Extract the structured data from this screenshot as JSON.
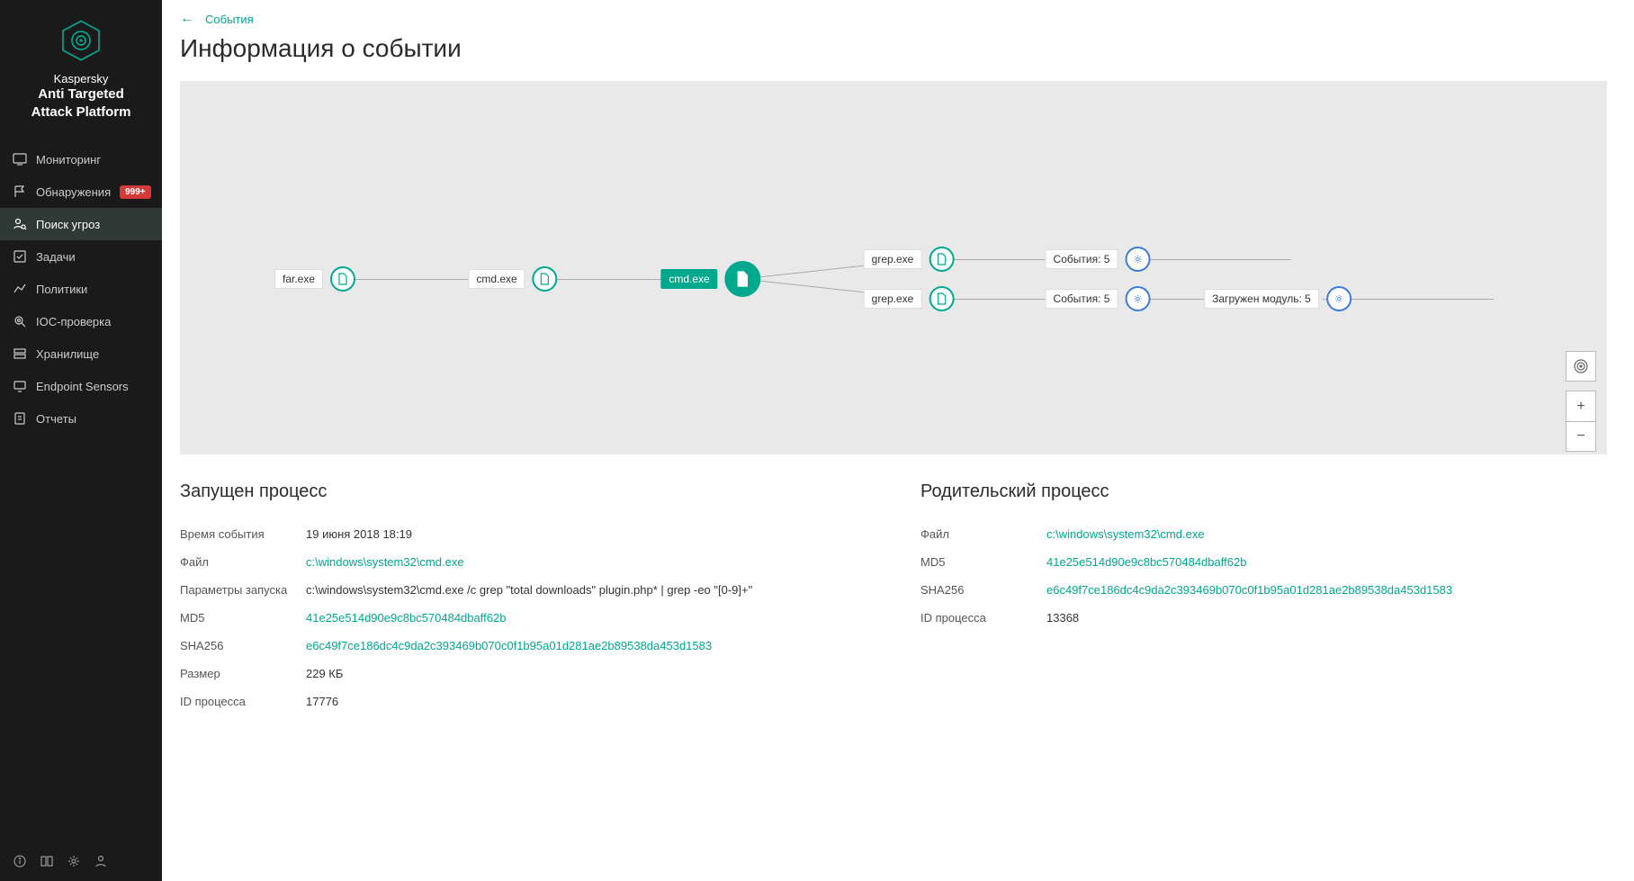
{
  "brand": {
    "name": "Kaspersky",
    "product_line1": "Anti Targeted",
    "product_line2": "Attack Platform"
  },
  "sidebar": {
    "items": [
      {
        "label": "Мониторинг"
      },
      {
        "label": "Обнаружения",
        "badge": "999+"
      },
      {
        "label": "Поиск угроз",
        "active": true
      },
      {
        "label": "Задачи"
      },
      {
        "label": "Политики"
      },
      {
        "label": "IOC-проверка"
      },
      {
        "label": "Хранилище"
      },
      {
        "label": "Endpoint Sensors"
      },
      {
        "label": "Отчеты"
      }
    ]
  },
  "breadcrumb": {
    "back": "←",
    "link": "События"
  },
  "page_title": "Информация о событии",
  "graph": {
    "nodes": {
      "far": "far.exe",
      "cmd1": "cmd.exe",
      "cmd2": "cmd.exe",
      "grep1": "grep.exe",
      "grep2": "grep.exe",
      "ev1": "События: 5",
      "ev2": "События: 5",
      "loaded": "Загружен модуль: 5"
    }
  },
  "controls": {
    "center": "◎",
    "plus": "+",
    "minus": "−"
  },
  "launched": {
    "title": "Запущен процесс",
    "rows": {
      "time_label": "Время события",
      "time_value": "19 июня 2018 18:19",
      "file_label": "Файл",
      "file_value": "c:\\windows\\system32\\cmd.exe",
      "params_label": "Параметры запуска",
      "params_value": "c:\\windows\\system32\\cmd.exe /c grep \"total downloads\" plugin.php* | grep -eo \"[0-9]+\"",
      "md5_label": "MD5",
      "md5_value": "41e25e514d90e9c8bc570484dbaff62b",
      "sha256_label": "SHA256",
      "sha256_value": "e6c49f7ce186dc4c9da2c393469b070c0f1b95a01d281ae2b89538da453d1583",
      "size_label": "Размер",
      "size_value": "229 КБ",
      "pid_label": "ID процесса",
      "pid_value": "17776"
    }
  },
  "parent": {
    "title": "Родительский процесс",
    "rows": {
      "file_label": "Файл",
      "file_value": "c:\\windows\\system32\\cmd.exe",
      "md5_label": "MD5",
      "md5_value": "41e25e514d90e9c8bc570484dbaff62b",
      "sha256_label": "SHA256",
      "sha256_value": "e6c49f7ce186dc4c9da2c393469b070c0f1b95a01d281ae2b89538da453d1583",
      "pid_label": "ID процесса",
      "pid_value": "13368"
    }
  }
}
